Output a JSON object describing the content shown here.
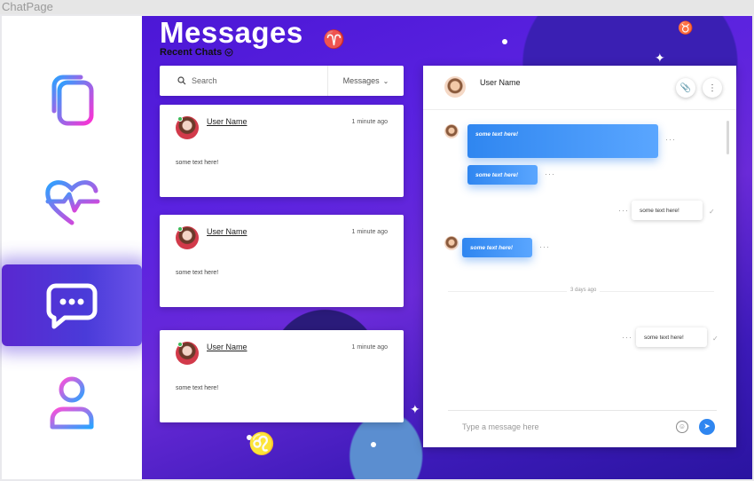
{
  "window": {
    "title": "ChatPage"
  },
  "sidebar": {
    "items": [
      {
        "icon": "copy-icon",
        "active": false
      },
      {
        "icon": "heart-pulse-icon",
        "active": false
      },
      {
        "icon": "chat-bubble-icon",
        "active": true
      },
      {
        "icon": "user-icon",
        "active": false
      }
    ]
  },
  "header": {
    "title": "Messages",
    "subtitle": "Recent Chats"
  },
  "search": {
    "placeholder": "Search",
    "filter": "Messages"
  },
  "chats": [
    {
      "name": "User Name",
      "time": "1 minute ago",
      "text": "some text here!"
    },
    {
      "name": "User Name",
      "time": "1 minute ago",
      "text": "some text here!"
    },
    {
      "name": "User Name",
      "time": "1 minute ago",
      "text": "some text here!"
    }
  ],
  "conversation": {
    "name": "User Name",
    "messages": [
      {
        "text": "some text here!",
        "from": "them"
      },
      {
        "text": "some text here!",
        "from": "them"
      },
      {
        "text": "some text here!",
        "from": "me"
      },
      {
        "text": "some text here!",
        "from": "them"
      },
      {
        "text": "some text here!",
        "from": "me"
      }
    ],
    "divider": "3 days ago",
    "compose_placeholder": "Type a message here"
  },
  "colors": {
    "accent": "#2f86f0",
    "background": "#4c17d6",
    "active_nav": "#5a28d0"
  }
}
